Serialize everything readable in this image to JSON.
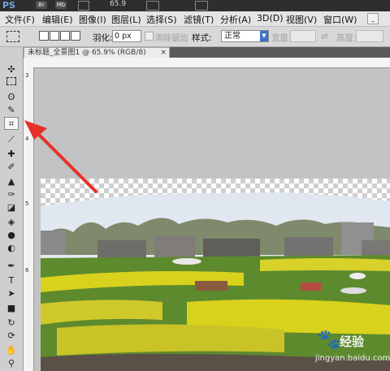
{
  "appbar": {
    "logo": "PS",
    "chips": [
      "Br",
      "Mb"
    ],
    "zoom": "65.9"
  },
  "menu": {
    "items": [
      "文件(F)",
      "编辑(E)",
      "图像(I)",
      "图层(L)",
      "选择(S)",
      "滤镜(T)",
      "分析(A)",
      "3D(D)",
      "视图(V)",
      "窗口(W)"
    ]
  },
  "options": {
    "feather_label": "羽化:",
    "feather_value": "0 px",
    "antialias_label": "消除锯齿",
    "style_label": "样式:",
    "style_value": "正常",
    "width_label": "宽度:",
    "height_label": "高度:"
  },
  "document": {
    "tab_title": "未标题_全景图1 @ 65.9% (RGB/8)",
    "close": "×"
  },
  "rulers": {
    "left_marks": [
      "3",
      "4",
      "5",
      "6"
    ]
  },
  "toolbox": {
    "tools": [
      "move-tool",
      "marquee-tool",
      "lasso-tool",
      "quick-select-tool",
      "crop-tool",
      "eyedropper-tool",
      "healing-tool",
      "brush-tool",
      "stamp-tool",
      "history-brush-tool",
      "eraser-tool",
      "gradient-tool",
      "blur-tool",
      "dodge-tool",
      "pen-tool",
      "type-tool",
      "path-select-tool",
      "shape-tool",
      "3d-rotate-tool",
      "3d-orbit-tool",
      "hand-tool",
      "zoom-tool"
    ],
    "active": "crop-tool"
  },
  "watermark": {
    "name": "经验",
    "url": "jingyan.baidu.com"
  },
  "colors": {
    "annotation_arrow": "#e8302a",
    "rapeseed_yellow": "#d9d21c",
    "field_green": "#5e8a2e"
  }
}
